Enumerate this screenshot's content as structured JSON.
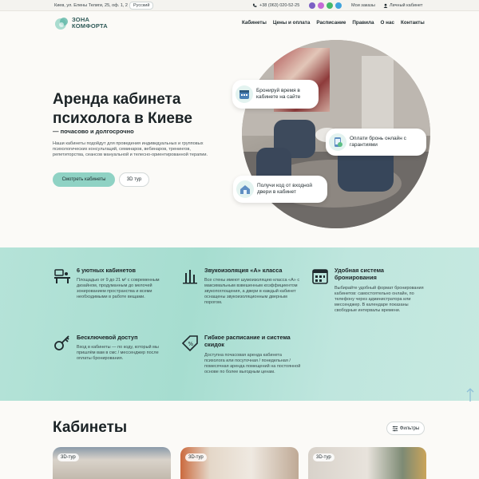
{
  "topbar": {
    "address": "Киев, ул. Елены Телиги, 25, оф. 1, 2",
    "language": "Русский",
    "phone": "+38 (063) 020-52-25",
    "orders": "Мои заказы",
    "cabinet": "Личный кабинет"
  },
  "logo": {
    "line1": "ЗОНА",
    "line2": "КОМФОРТА"
  },
  "nav": [
    "Кабинеты",
    "Цены и оплата",
    "Расписание",
    "Правила",
    "О нас",
    "Контакты"
  ],
  "hero": {
    "title": "Аренда кабинета психолога в Киеве",
    "subtitle": "— почасово и долгосрочно",
    "description": "Наши кабинеты подойдут для проведения индивидуальных и групповых психологических консультаций, семинаров, вебинаров, тренингов, репетиторства, сеансов мануальной и телесно-ориентированной терапии.",
    "primary_button": "Смотреть кабинеты",
    "secondary_button": "3D тур"
  },
  "tips": [
    "Бронируй время в кабинете на сайте",
    "Оплати бронь онлайн с гарантиями",
    "Получи код от входной двери в кабинет"
  ],
  "features": [
    {
      "title": "6 уютных кабинетов",
      "text": "Площадью от 9 до 21 м² с современным дизайном, продуманным до мелочей зонированием пространства и всеми необходимыми в работе вещами."
    },
    {
      "title": "Звукоизоляция «А» класса",
      "text": "Все стены имеют шумоизоляцию класса «А» с максимальным взвешенным коэффициентом звукопоглощения, а двери в каждый кабинет оснащены звукоизоляционным дверным порогом."
    },
    {
      "title": "Удобная система бронирования",
      "text": "Выбирайте удобный формат бронирования кабинетов: самостоятельно онлайн, по телефону через администратора или мессенджер. В календаре показаны свободные интервалы времени."
    },
    {
      "title": "Бесключевой доступ",
      "text": "Вход в кабинеты — по коду, который мы пришлём вам в смс / мессенджер после оплаты бронирования."
    },
    {
      "title": "Гибкое расписание и система скидок",
      "text": "Доступна почасовая аренда кабинета психолога или посуточная / понедельная / помесячная аренда помещений на постоянной основе по более выгодным ценам."
    }
  ],
  "cabinets": {
    "title": "Кабинеты",
    "filters": "Фильтры",
    "cards": [
      {
        "tag": "3D-тур"
      },
      {
        "tag": "3D-тур"
      },
      {
        "tag": "3D-тур"
      }
    ]
  },
  "colors": {
    "accent": "#8fd2c4",
    "band": "#a6ddd0",
    "text": "#1b2326"
  }
}
